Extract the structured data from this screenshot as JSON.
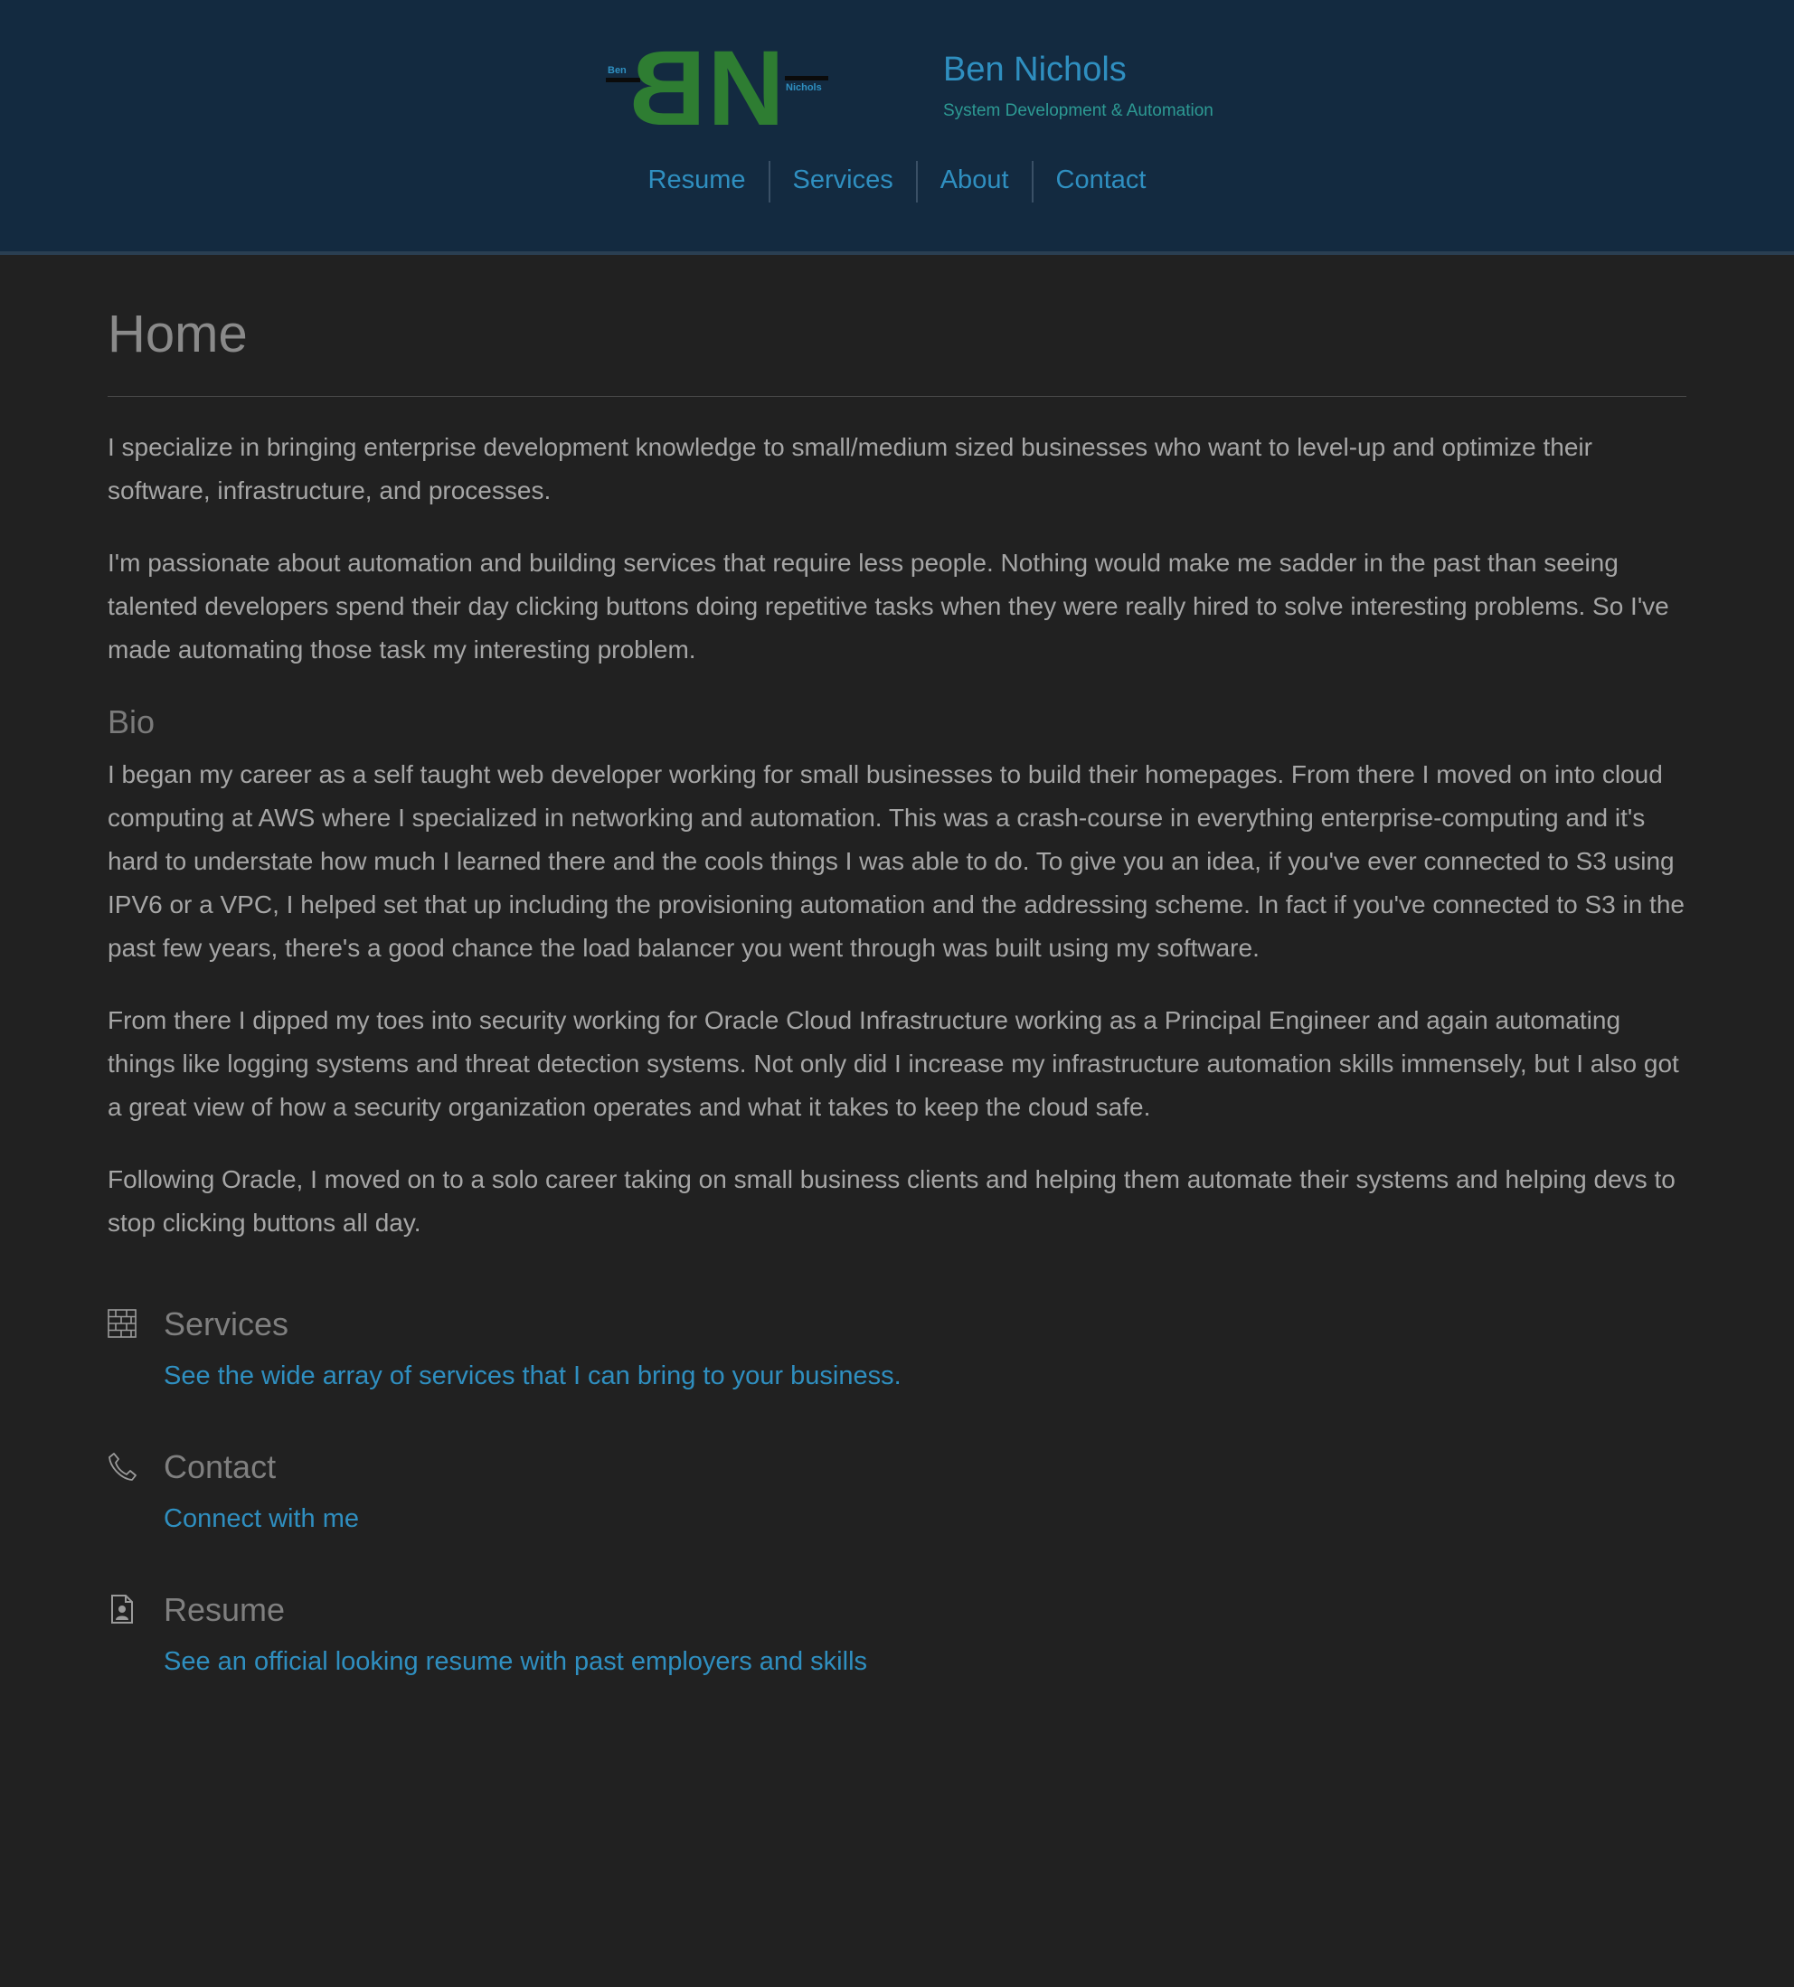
{
  "header": {
    "logo": {
      "initials_first": "B",
      "initials_second": "N",
      "small_left": "Ben",
      "small_right": "Nichols",
      "color": "#2e7d32"
    },
    "site_title": "Ben Nichols",
    "site_subtitle": "System Development & Automation",
    "nav": [
      {
        "label": "Resume"
      },
      {
        "label": "Services"
      },
      {
        "label": "About"
      },
      {
        "label": "Contact"
      }
    ]
  },
  "main": {
    "page_title": "Home",
    "intro": [
      "I specialize in bringing enterprise development knowledge to small/medium sized businesses who want to level-up and optimize their software, infrastructure, and processes.",
      "I'm passionate about automation and building services that require less people. Nothing would make me sadder in the past than seeing talented developers spend their day clicking buttons doing repetitive tasks when they were really hired to solve interesting problems. So I've made automating those task my interesting problem."
    ],
    "bio_heading": "Bio",
    "bio": [
      "I began my career as a self taught web developer working for small businesses to build their homepages. From there I moved on into cloud computing at AWS where I specialized in networking and automation. This was a crash-course in everything enterprise-computing and it's hard to understate how much I learned there and the cools things I was able to do. To give you an idea, if you've ever connected to S3 using IPV6 or a VPC, I helped set that up including the provisioning automation and the addressing scheme. In fact if you've connected to S3 in the past few years, there's a good chance the load balancer you went through was built using my software.",
      "From there I dipped my toes into security working for Oracle Cloud Infrastructure working as a Principal Engineer and again automating things like logging systems and threat detection systems. Not only did I increase my infrastructure automation skills immensely, but I also got a great view of how a security organization operates and what it takes to keep the cloud safe.",
      "Following Oracle, I moved on to a solo career taking on small business clients and helping them automate their systems and helping devs to stop clicking buttons all day."
    ],
    "features": [
      {
        "icon": "brick-wall-icon",
        "title": "Services",
        "link": "See the wide array of services that I can bring to your business."
      },
      {
        "icon": "phone-icon",
        "title": "Contact",
        "link": "Connect with me"
      },
      {
        "icon": "resume-document-icon",
        "title": "Resume",
        "link": "See an official looking resume with past employers and skills"
      }
    ]
  },
  "colors": {
    "header_bg": "#132a40",
    "page_bg": "#212121",
    "link": "#2f8fc0",
    "subtitle": "#2d9a93",
    "body_text": "#a6a6a6",
    "heading": "#8a8a8a"
  }
}
